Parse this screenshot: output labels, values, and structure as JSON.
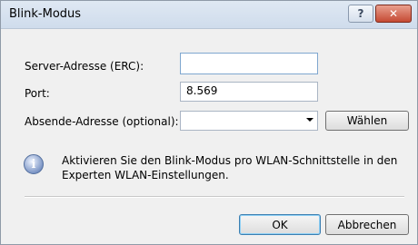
{
  "window": {
    "title": "Blink-Modus",
    "help_label": "?",
    "close_label": "✕"
  },
  "form": {
    "server_label": "Server-Adresse (ERC):",
    "server_value": "",
    "port_label": "Port:",
    "port_value": "8.569",
    "sender_label": "Absende-Adresse (optional):",
    "sender_value": "",
    "choose_label": "Wählen"
  },
  "info": {
    "icon": "info-icon",
    "line1": "Aktivieren Sie den Blink-Modus pro WLAN-Schnittstelle in den",
    "line2": "Experten WLAN-Einstellungen."
  },
  "buttons": {
    "ok_label": "OK",
    "cancel_label": "Abbrechen"
  }
}
